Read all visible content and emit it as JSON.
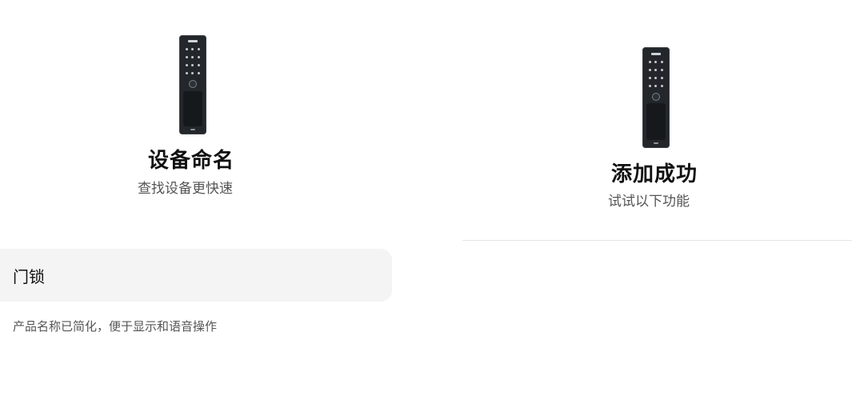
{
  "left_panel": {
    "title": "设备命名",
    "subtitle": "查找设备更快速",
    "name_field": {
      "value": "门锁"
    },
    "hint": "产品名称已简化，便于显示和语音操作",
    "device_image": "smart-door-lock"
  },
  "right_panel": {
    "title": "添加成功",
    "subtitle": "试试以下功能",
    "device_image": "smart-door-lock"
  },
  "colors": {
    "background": "#ffffff",
    "field_background": "#f4f4f4",
    "device_body": "#23272b",
    "divider": "#e6e6e6"
  }
}
